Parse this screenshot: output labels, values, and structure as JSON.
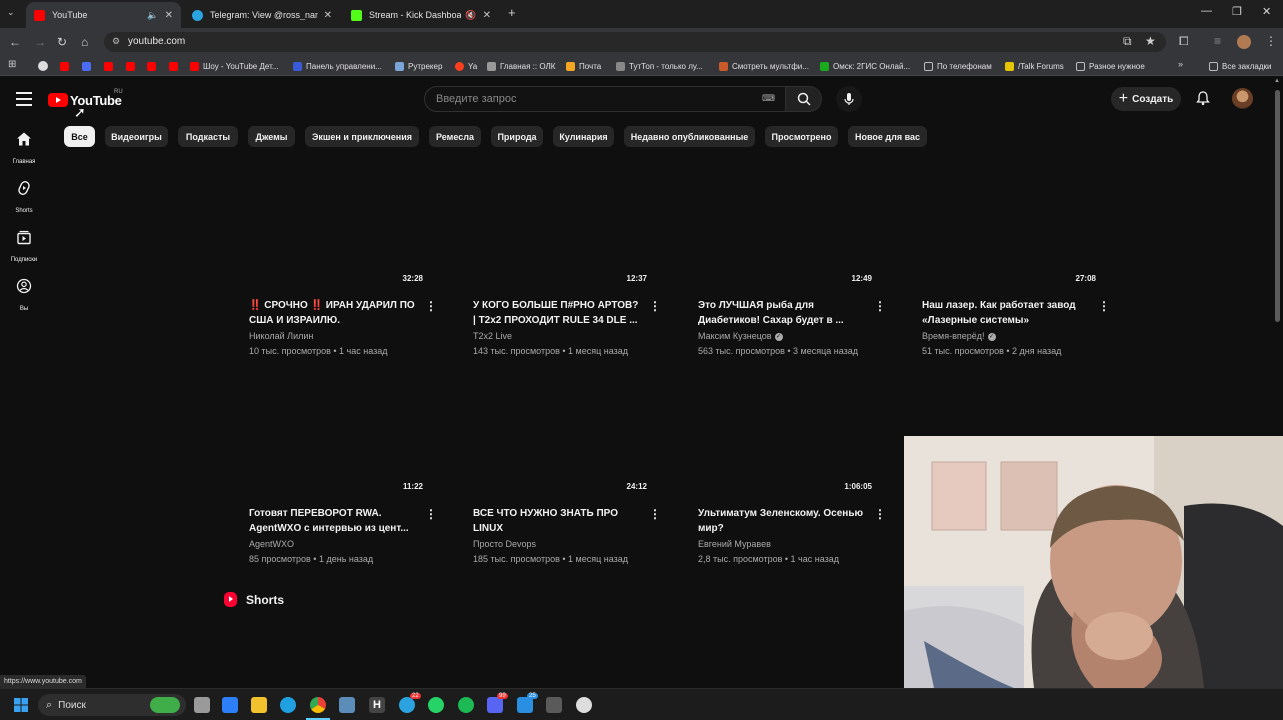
{
  "browser": {
    "tabs": [
      {
        "title": "YouTube",
        "favicon_color": "#ff0000",
        "active": true,
        "muted_icon": "speaker-icon"
      },
      {
        "title": "Telegram: View @ross_name",
        "favicon_color": "#2aa3e0",
        "active": false
      },
      {
        "title": "Stream - Kick Dashboard",
        "favicon_color": "#53fc18",
        "active": false,
        "muted_icon": "mute-icon"
      }
    ],
    "url": "youtube.com",
    "bookmarks": [
      {
        "label": "",
        "color": "#ff0000"
      },
      {
        "label": "",
        "color": "#ff0000"
      },
      {
        "label": "",
        "color": "#ff0000"
      },
      {
        "label": "",
        "color": "#ff0000"
      },
      {
        "label": "Шоу - YouTube Дет...",
        "color": "#ff0000"
      },
      {
        "label": "Панель управлени...",
        "color": "#3a5bd9"
      },
      {
        "label": "Рутрекер",
        "color": "#7aa5d6"
      },
      {
        "label": "Ya",
        "color": "#fc3f1d"
      },
      {
        "label": "Главная :: ОЛК",
        "color": "#999999"
      },
      {
        "label": "Почта",
        "color": "#f5a623"
      },
      {
        "label": "ТутТоп - только лу...",
        "color": "#888888"
      },
      {
        "label": "Смотреть мультфи...",
        "color": "#c85a2a"
      },
      {
        "label": "Омск: 2ГИС Онлай...",
        "color": "#19aa1e"
      },
      {
        "label": "По телефонам",
        "color": "#bbbbbb"
      },
      {
        "label": "/Talk Forums",
        "color": "#e6c400"
      },
      {
        "label": "Разное нужное",
        "color": "#bbbbbb"
      }
    ],
    "all_bookmarks": "Все закладки",
    "status_url": "https://www.youtube.com"
  },
  "youtube": {
    "logo_text": "YouTube",
    "country": "RU",
    "search_placeholder": "Введите запрос",
    "create_label": "Создать",
    "rail": [
      {
        "label": "Главная",
        "icon": "home-icon"
      },
      {
        "label": "Shorts",
        "icon": "shorts-icon"
      },
      {
        "label": "Подписки",
        "icon": "subscriptions-icon"
      },
      {
        "label": "Вы",
        "icon": "you-icon"
      }
    ],
    "chips": [
      "Все",
      "Видеоигры",
      "Подкасты",
      "Джемы",
      "Экшен и приключения",
      "Ремесла",
      "Природа",
      "Кулинария",
      "Недавно опубликованные",
      "Просмотрено",
      "Новое для вас"
    ],
    "videos": [
      {
        "duration": "32:28",
        "title": "‼️ СРОЧНО ‼️ ИРАН УДАРИЛ ПО США И ИЗРАИЛЮ.",
        "channel": "Николай Лилин",
        "verified": false,
        "meta": "10 тыс. просмотров • 1 час назад"
      },
      {
        "duration": "12:37",
        "title": "У КОГО БОЛЬШЕ П#РНО АРТОВ? | T2x2 ПРОХОДИТ RULE 34 DLE ...",
        "channel": "T2x2 Live",
        "verified": false,
        "meta": "143 тыс. просмотров • 1 месяц назад"
      },
      {
        "duration": "12:49",
        "title": "Это ЛУЧШАЯ рыба для Диабетиков! Сахар будет в ...",
        "channel": "Максим Кузнецов",
        "verified": true,
        "meta": "563 тыс. просмотров • 3 месяца назад"
      },
      {
        "duration": "27:08",
        "title": "Наш лазер. Как работает завод «Лазерные системы»",
        "channel": "Время-вперёд!",
        "verified": true,
        "meta": "51 тыс. просмотров • 2 дня назад"
      },
      {
        "duration": "11:22",
        "title": "Готовят ПЕРЕВОРОТ RWA. AgentWXO с интервью из цент...",
        "channel": "AgentWXO",
        "verified": false,
        "meta": "85 просмотров • 1 день назад"
      },
      {
        "duration": "24:12",
        "title": "ВСЕ ЧТО НУЖНО ЗНАТЬ ПРО LINUX",
        "channel": "Просто Devops",
        "verified": false,
        "meta": "185 тыс. просмотров • 1 месяц назад"
      },
      {
        "duration": "1:06:05",
        "title": "Ультиматум Зеленскому. Осенью мир?",
        "channel": "Евгений Муравев",
        "verified": false,
        "meta": "2,8 тыс. просмотров • 1 час назад"
      }
    ],
    "shorts_heading": "Shorts"
  },
  "taskbar": {
    "search_label": "Поиск",
    "apps": [
      {
        "name": "weather-widget-icon",
        "color": "#3fae49"
      },
      {
        "name": "task-view-icon",
        "color": "#9a9a9a"
      },
      {
        "name": "store-icon",
        "color": "#2d7ff9"
      },
      {
        "name": "file-explorer-icon",
        "color": "#f2c12e"
      },
      {
        "name": "edge-icon",
        "color": "#1fa0e0"
      },
      {
        "name": "chrome-icon",
        "color": "#e94235"
      },
      {
        "name": "steam-icon",
        "color": "#5b8db8"
      },
      {
        "name": "h-app-icon",
        "color": "#444444"
      },
      {
        "name": "telegram-icon",
        "color": "#2aa3e0"
      },
      {
        "name": "whatsapp-icon",
        "color": "#25d366"
      },
      {
        "name": "spotify-icon",
        "color": "#1db954"
      },
      {
        "name": "discord-icon",
        "color": "#5865f2"
      },
      {
        "name": "app-badge-icon",
        "color": "#2a8fe0"
      },
      {
        "name": "calculator-icon",
        "color": "#5a5a5a"
      },
      {
        "name": "obs-icon",
        "color": "#dddddd"
      }
    ],
    "badges": {
      "telegram": "22",
      "discord": "99",
      "app": "25"
    }
  }
}
